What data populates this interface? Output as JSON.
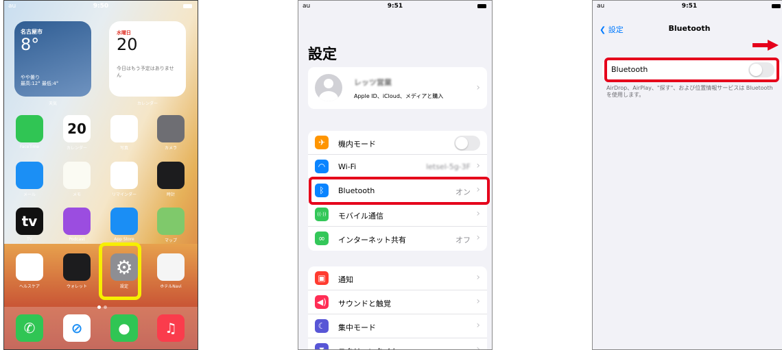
{
  "colors": {
    "accent_blue": "#007aff",
    "highlight_red": "#e5001b",
    "highlight_yellow": "#f7ef00"
  },
  "home": {
    "status": {
      "carrier": "au",
      "time": "9:50"
    },
    "weather_widget": {
      "city": "名古屋市",
      "temp": "8°",
      "condition": "やや曇り",
      "range": "最高:12° 最低:4°",
      "label": "天気"
    },
    "calendar_widget": {
      "day": "水曜日",
      "date": "20",
      "note": "今日はもう予定はありません",
      "label": "カレンダー"
    },
    "apps": [
      {
        "name": "FaceTime",
        "icon": "video-camera-icon",
        "color": "#30c554"
      },
      {
        "name": "カレンダー",
        "icon": "calendar-icon",
        "color": "#ffffff",
        "glyph": "20"
      },
      {
        "name": "写真",
        "icon": "photos-flower-icon",
        "color": "#ffffff"
      },
      {
        "name": "カメラ",
        "icon": "camera-icon",
        "color": "#6e6e73"
      },
      {
        "name": "メール",
        "icon": "mail-envelope-icon",
        "color": "#1b8ff5"
      },
      {
        "name": "メモ",
        "icon": "notes-icon",
        "color": "#fbfbf3"
      },
      {
        "name": "リマインダー",
        "icon": "reminders-list-icon",
        "color": "#ffffff"
      },
      {
        "name": "時計",
        "icon": "clock-icon",
        "color": "#1c1c1e"
      },
      {
        "name": "TV",
        "icon": "apple-tv-icon",
        "color": "#111111",
        "glyph": "tv"
      },
      {
        "name": "Podcast",
        "icon": "podcast-icon",
        "color": "#9b4de0"
      },
      {
        "name": "App Store",
        "icon": "app-store-icon",
        "color": "#1a8ef5"
      },
      {
        "name": "マップ",
        "icon": "maps-icon",
        "color": "#7fc96b"
      },
      {
        "name": "ヘルスケア",
        "icon": "health-heart-icon",
        "color": "#ffffff"
      },
      {
        "name": "ウォレット",
        "icon": "wallet-icon",
        "color": "#1c1c1e"
      },
      {
        "name": "設定",
        "icon": "settings-gear-icon",
        "color": "#8e8e93"
      },
      {
        "name": "ホテルNavi",
        "icon": "hotel-app-icon",
        "color": "#f5f5f5"
      }
    ],
    "dock": [
      {
        "name": "電話",
        "icon": "phone-icon",
        "color": "#30c554"
      },
      {
        "name": "Safari",
        "icon": "safari-compass-icon",
        "color": "#ffffff"
      },
      {
        "name": "メッセージ",
        "icon": "messages-bubble-icon",
        "color": "#30c554"
      },
      {
        "name": "ミュージック",
        "icon": "music-note-icon",
        "color": "#fa3c4c"
      }
    ]
  },
  "settings": {
    "status": {
      "carrier": "au",
      "time": "9:51"
    },
    "title": "設定",
    "profile": {
      "name": "レッツ営業",
      "sub": "Apple ID、iCloud、メディアと購入"
    },
    "group1": [
      {
        "label": "機内モード",
        "icon": "airplane-icon",
        "color": "#ff9500",
        "glyph": "✈",
        "value": "",
        "toggle": true
      },
      {
        "label": "Wi-Fi",
        "icon": "wifi-icon",
        "color": "#0a84ff",
        "glyph": "◠",
        "value": "letsel-5g-3F",
        "toggle": false
      },
      {
        "label": "Bluetooth",
        "icon": "bluetooth-icon",
        "color": "#0a84ff",
        "glyph": "ᛒ",
        "value": "オン",
        "toggle": false
      },
      {
        "label": "モバイル通信",
        "icon": "cellular-antenna-icon",
        "color": "#34c759",
        "glyph": "((·))",
        "value": "",
        "toggle": false
      },
      {
        "label": "インターネット共有",
        "icon": "hotspot-link-icon",
        "color": "#34c759",
        "glyph": "∞",
        "value": "オフ",
        "toggle": false
      }
    ],
    "group2": [
      {
        "label": "通知",
        "icon": "notification-bell-icon",
        "color": "#ff3b30",
        "glyph": "▣"
      },
      {
        "label": "サウンドと触覚",
        "icon": "speaker-icon",
        "color": "#ff2d55",
        "glyph": "◀)"
      },
      {
        "label": "集中モード",
        "icon": "moon-icon",
        "color": "#5856d6",
        "glyph": "☾"
      },
      {
        "label": "スクリーンタイム",
        "icon": "hourglass-icon",
        "color": "#5856d6",
        "glyph": "⧗"
      }
    ]
  },
  "bluetooth": {
    "status": {
      "carrier": "au",
      "time": "9:51"
    },
    "back": "設定",
    "title": "Bluetooth",
    "row_label": "Bluetooth",
    "footnote": "AirDrop、AirPlay、\"探す\"、および位置情報サービスは Bluetooth を使用します。"
  }
}
